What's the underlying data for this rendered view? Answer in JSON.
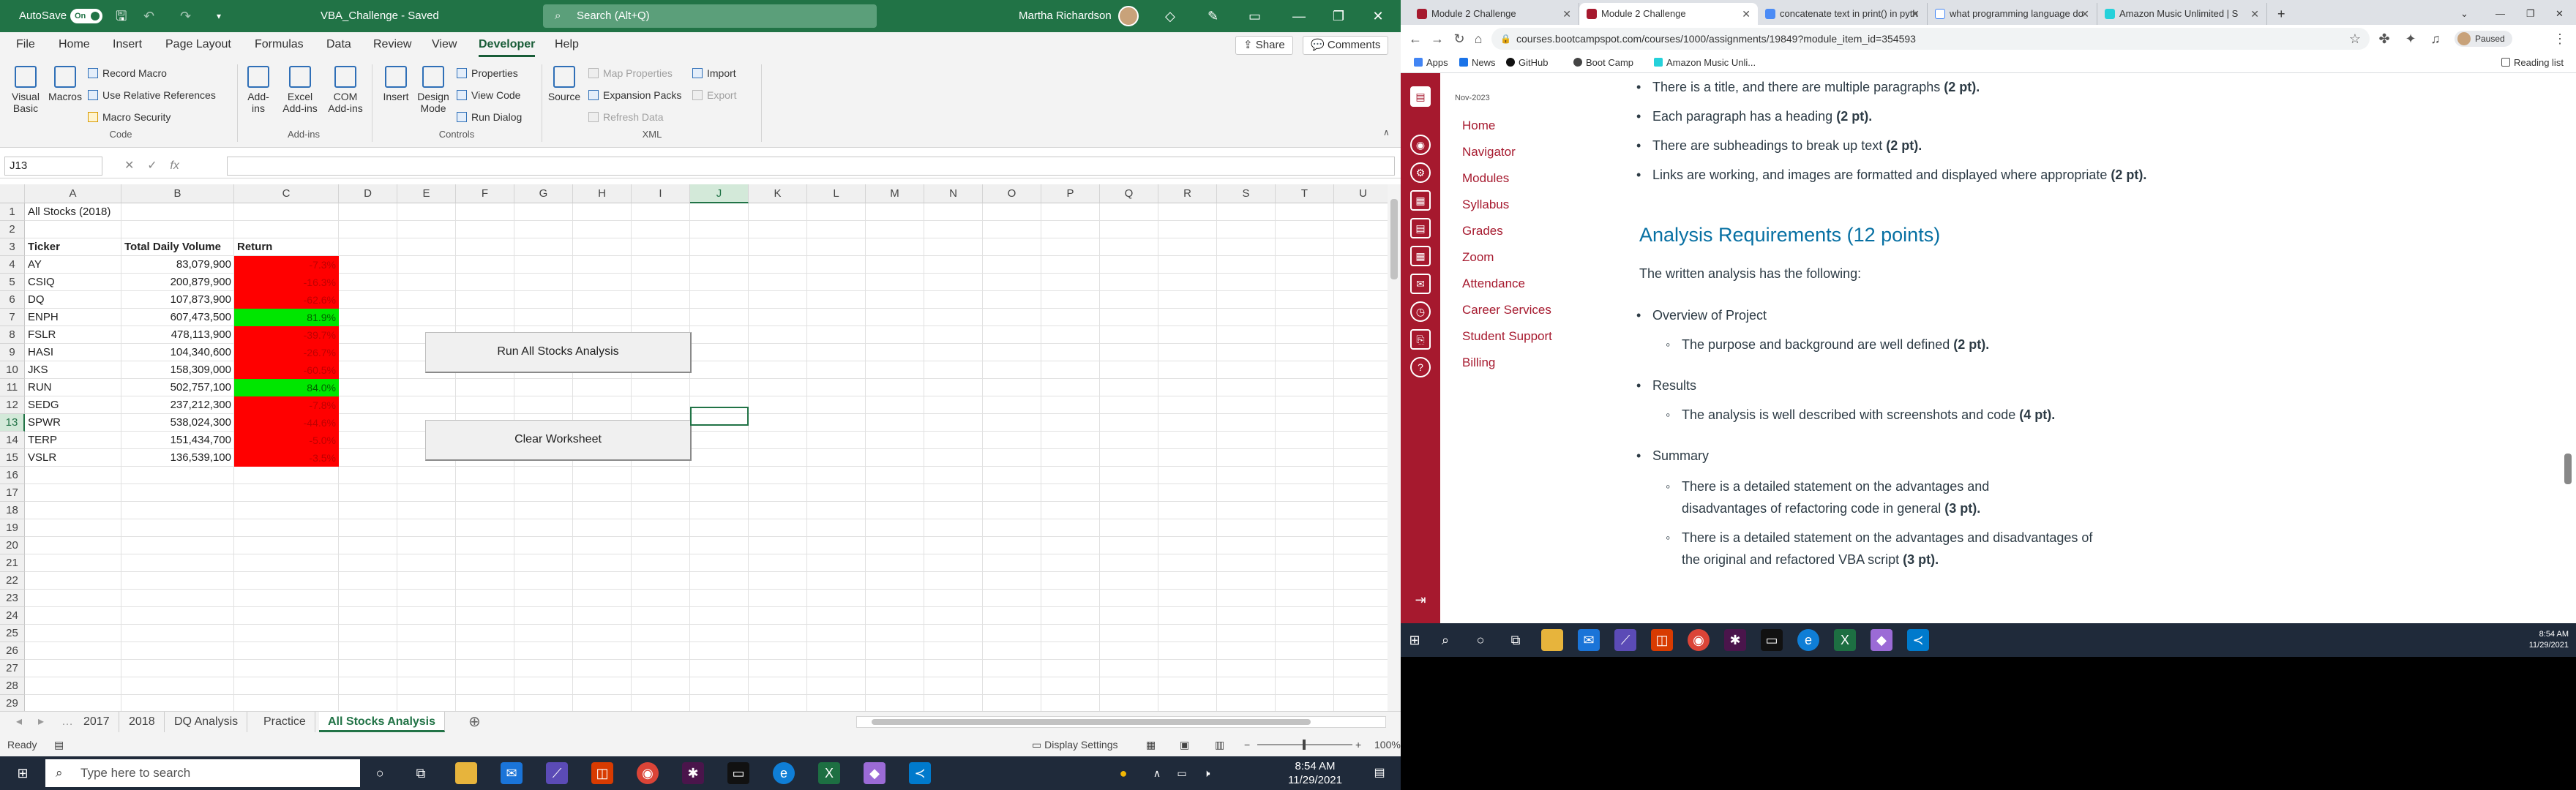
{
  "excel": {
    "autosave_label": "AutoSave",
    "autosave_state": "On",
    "doc_title": "VBA_Challenge  -  Saved",
    "search_placeholder": "Search (Alt+Q)",
    "user_name": "Martha Richardson",
    "menu": [
      "File",
      "Home",
      "Insert",
      "Page Layout",
      "Formulas",
      "Data",
      "Review",
      "View",
      "Developer",
      "Help"
    ],
    "active_menu": "Developer",
    "share_label": "Share",
    "comments_label": "Comments",
    "ribbon": {
      "code": {
        "label": "Code",
        "visual_basic": "Visual Basic",
        "macros": "Macros",
        "record_macro": "Record Macro",
        "relative_refs": "Use Relative References",
        "macro_security": "Macro Security"
      },
      "addins": {
        "label": "Add-ins",
        "addins": "Add-ins",
        "excel_addins": "Excel Add-ins",
        "com_addins": "COM Add-ins"
      },
      "controls": {
        "label": "Controls",
        "insert": "Insert",
        "design_mode": "Design Mode",
        "properties": "Properties",
        "view_code": "View Code",
        "run_dialog": "Run Dialog"
      },
      "xml": {
        "label": "XML",
        "source": "Source",
        "map_properties": "Map Properties",
        "expansion_packs": "Expansion Packs",
        "refresh_data": "Refresh Data",
        "import": "Import",
        "export": "Export"
      }
    },
    "name_box": "J13",
    "fx_label": "fx",
    "columns": [
      "A",
      "B",
      "C",
      "D",
      "E",
      "F",
      "G",
      "H",
      "I",
      "J",
      "K",
      "L",
      "M",
      "N",
      "O",
      "P",
      "Q",
      "R",
      "S",
      "T",
      "U"
    ],
    "selected_column": "J",
    "selected_row": "13",
    "sheet_title": "All Stocks (2018)",
    "headers": {
      "ticker": "Ticker",
      "volume": "Total Daily Volume",
      "return": "Return"
    },
    "rows": [
      {
        "ticker": "AY",
        "volume": "83,079,900",
        "return": "-7.3%",
        "positive": false
      },
      {
        "ticker": "CSIQ",
        "volume": "200,879,900",
        "return": "-16.3%",
        "positive": false
      },
      {
        "ticker": "DQ",
        "volume": "107,873,900",
        "return": "-62.6%",
        "positive": false
      },
      {
        "ticker": "ENPH",
        "volume": "607,473,500",
        "return": "81.9%",
        "positive": true
      },
      {
        "ticker": "FSLR",
        "volume": "478,113,900",
        "return": "-39.7%",
        "positive": false
      },
      {
        "ticker": "HASI",
        "volume": "104,340,600",
        "return": "-26.7%",
        "positive": false
      },
      {
        "ticker": "JKS",
        "volume": "158,309,000",
        "return": "-60.5%",
        "positive": false
      },
      {
        "ticker": "RUN",
        "volume": "502,757,100",
        "return": "84.0%",
        "positive": true
      },
      {
        "ticker": "SEDG",
        "volume": "237,212,300",
        "return": "-7.8%",
        "positive": false
      },
      {
        "ticker": "SPWR",
        "volume": "538,024,300",
        "return": "-44.6%",
        "positive": false
      },
      {
        "ticker": "TERP",
        "volume": "151,434,700",
        "return": "-5.0%",
        "positive": false
      },
      {
        "ticker": "VSLR",
        "volume": "136,539,100",
        "return": "-3.5%",
        "positive": false
      }
    ],
    "buttons": {
      "run": "Run All Stocks Analysis",
      "clear": "Clear Worksheet"
    },
    "sheets": [
      "2017",
      "2018",
      "DQ Analysis",
      "Practice",
      "All Stocks Analysis"
    ],
    "active_sheet": "All Stocks Analysis",
    "status": {
      "ready": "Ready",
      "display_settings": "Display Settings",
      "zoom": "100%"
    },
    "colors": {
      "brand": "#217346",
      "negative": "#ff0000",
      "positive": "#00e600"
    }
  },
  "taskbar": {
    "search_placeholder": "Type here to search",
    "time": "8:54 AM",
    "date": "11/29/2021"
  },
  "browser": {
    "tabs": [
      {
        "title": "Module 2 Challenge",
        "active": false
      },
      {
        "title": "Module 2 Challenge",
        "active": true
      },
      {
        "title": "concatenate text in print() in pyth",
        "active": false
      },
      {
        "title": "what programming language do",
        "active": false
      },
      {
        "title": "Amazon Music Unlimited | S",
        "active": false
      }
    ],
    "url": "courses.bootcampspot.com/courses/1000/assignments/19849?module_item_id=354593",
    "paused_label": "Paused",
    "bookmarks": [
      "Apps",
      "News",
      "GitHub",
      "Boot Camp",
      "Amazon Music Unli..."
    ],
    "reading_list": "Reading list",
    "nav_date": "Nov-2023",
    "nav_links": [
      "Home",
      "Navigator",
      "Modules",
      "Syllabus",
      "Grades",
      "Zoom",
      "Attendance",
      "Career Services",
      "Student Support",
      "Billing"
    ],
    "content": {
      "top_bullets": [
        {
          "text": "There is a title, and there are multiple paragraphs ",
          "pts": "(2 pt)."
        },
        {
          "text": "Each paragraph has a heading ",
          "pts": "(2 pt)."
        },
        {
          "text": "There are subheadings to break up text ",
          "pts": "(2 pt)."
        },
        {
          "text": "Links are working, and images are formatted and displayed where appropriate ",
          "pts": "(2 pt)."
        }
      ],
      "heading": "Analysis Requirements (12 points)",
      "intro": "The written analysis has the following:",
      "sections": [
        {
          "title": "Overview of Project",
          "items": [
            {
              "text": "The purpose and background are well defined ",
              "pts": "(2 pt)."
            }
          ]
        },
        {
          "title": "Results",
          "items": [
            {
              "text": "The analysis is well described with screenshots and code ",
              "pts": "(4 pt)."
            }
          ]
        },
        {
          "title": "Summary",
          "items": [
            {
              "text": "There is a detailed statement on the advantages and disadvantages of refactoring code in general ",
              "pts": "(3 pt)."
            },
            {
              "text": "There is a detailed statement on the advantages and disadvantages of the original and refactored VBA script ",
              "pts": "(3 pt)."
            }
          ]
        }
      ]
    },
    "taskbar_time": "8:54 AM",
    "taskbar_date": "11/29/2021"
  }
}
